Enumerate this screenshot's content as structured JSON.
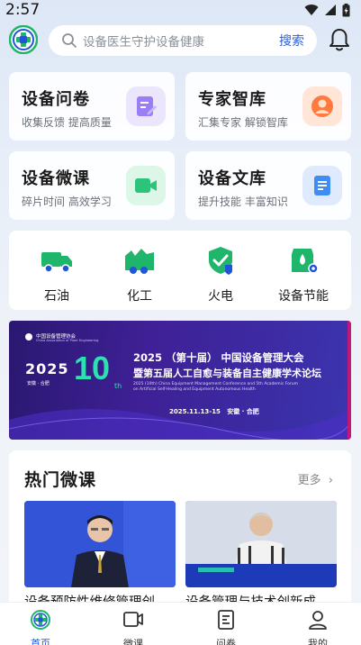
{
  "status_bar": {
    "time": "2:57"
  },
  "search": {
    "placeholder": "设备医生守护设备健康",
    "button": "搜索"
  },
  "feature_cards": [
    {
      "title": "设备问卷",
      "subtitle": "收集反馈 提高质量",
      "icon": "questionnaire-icon",
      "accent": "#8b6cf0"
    },
    {
      "title": "专家智库",
      "subtitle": "汇集专家 解锁智库",
      "icon": "expert-icon",
      "accent": "#ff7a3c"
    },
    {
      "title": "设备微课",
      "subtitle": "碎片时间 高效学习",
      "icon": "video-icon",
      "accent": "#2bc47a"
    },
    {
      "title": "设备文库",
      "subtitle": "提升技能 丰富知识",
      "icon": "document-icon",
      "accent": "#3f8cf5"
    }
  ],
  "categories": [
    {
      "label": "石油",
      "icon": "truck-icon"
    },
    {
      "label": "化工",
      "icon": "factory-icon"
    },
    {
      "label": "火电",
      "icon": "shield-bolt-icon"
    },
    {
      "label": "设备节能",
      "icon": "energy-gear-icon"
    }
  ],
  "banner": {
    "org": "中国设备管理协会",
    "org_en": "China Association of Plant Engineering",
    "year_mark": "2025",
    "tenth": "10",
    "tenth_suffix": "th",
    "date_tag": "安徽 · 合肥",
    "title_line1": "2025 （第十届） 中国设备管理大会",
    "title_line2": "暨第五届人工自愈与装备自主健康学术论坛",
    "en_line1": "2025 (10th) China Equipment Management Conference and 5th Academic Forum",
    "en_line2": "on Artificial Self-Healing and Equipment Autonomous Health",
    "when_where": "2025.11.13-15   安徽 · 合肥"
  },
  "hot_courses": {
    "title": "热门微课",
    "more": "更多",
    "items": [
      {
        "title": "设备预防性维修管理创"
      },
      {
        "title": "设备管理与技术创新成"
      }
    ]
  },
  "tabs": [
    {
      "label": "首页",
      "icon": "home-icon",
      "active": true
    },
    {
      "label": "微课",
      "icon": "video-icon",
      "active": false
    },
    {
      "label": "问卷",
      "icon": "questionnaire-icon",
      "active": false
    },
    {
      "label": "我的",
      "icon": "user-icon",
      "active": false
    }
  ],
  "colors": {
    "primary": "#1f55d6",
    "green": "#1fb56a"
  }
}
